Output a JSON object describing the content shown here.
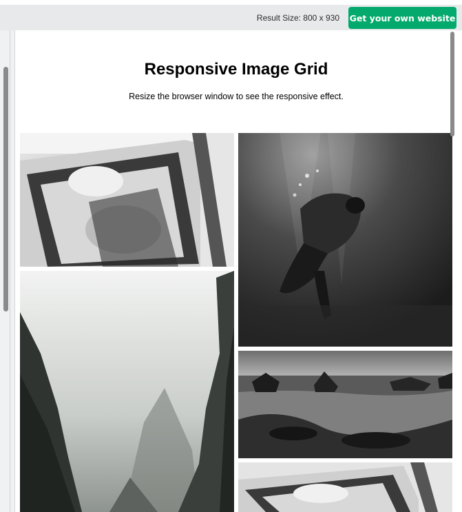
{
  "topbar": {
    "result_size": "Result Size: 800 x 930",
    "cta_label": "Get your own website"
  },
  "page": {
    "title": "Responsive Image Grid",
    "subtitle": "Resize the browser window to see the responsive effect."
  },
  "images": [
    {
      "subject": "wedding couple in car window",
      "icon": "wedding-photo"
    },
    {
      "subject": "foggy mountain cliffs",
      "icon": "mountains-photo"
    },
    {
      "subject": "underwater dancer",
      "icon": "underwater-photo"
    },
    {
      "subject": "rocky seashore",
      "icon": "rocks-photo"
    },
    {
      "subject": "wedding couple in car window",
      "icon": "wedding-photo"
    }
  ],
  "colors": {
    "cta": "#04aa6d",
    "topbar": "#e8e9eb"
  }
}
